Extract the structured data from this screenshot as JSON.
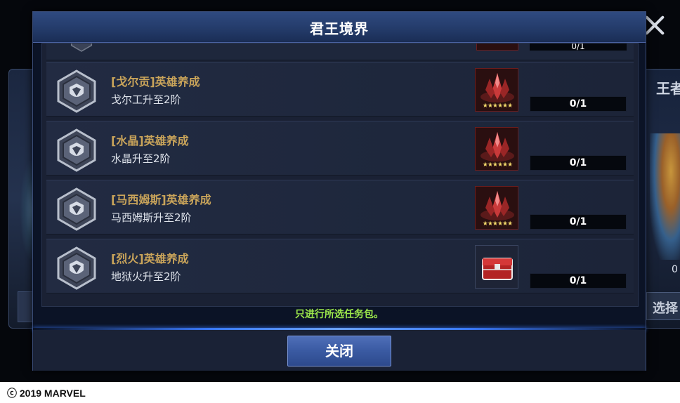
{
  "modal": {
    "title": "君王境界",
    "notice": "只进行所选任务包。",
    "close_label": "关闭"
  },
  "tasks": [
    {
      "title": "[戈尔贡]英雄养成",
      "desc": "戈尔工升至2阶",
      "reward_icon": "ruby-crystal-reward-icon",
      "reward_stars": "★★★★★★",
      "progress_text": "0/1",
      "progress_value": 0
    },
    {
      "title": "[水晶]英雄养成",
      "desc": "水晶升至2阶",
      "reward_icon": "ruby-crystal-reward-icon",
      "reward_stars": "★★★★★★",
      "progress_text": "0/1",
      "progress_value": 0
    },
    {
      "title": "[马西姆斯]英雄养成",
      "desc": "马西姆斯升至2阶",
      "reward_icon": "ruby-crystal-reward-icon",
      "reward_stars": "★★★★★★",
      "progress_text": "0/1",
      "progress_value": 0
    },
    {
      "title": "[烈火]英雄养成",
      "desc": "地狱火升至2阶",
      "reward_icon": "red-chest-reward-icon",
      "reward_stars": "",
      "progress_text": "0/1",
      "progress_value": 0
    }
  ],
  "partial_row": {
    "progress_text": "0/1"
  },
  "background": {
    "right_panel_title": "王者",
    "right_panel_count": "0",
    "right_panel_button": "选择"
  },
  "footer": {
    "copyright": "ⓒ 2019 MARVEL"
  },
  "colors": {
    "task_title": "#c9a45a",
    "notice": "#9ce84b",
    "header": "#2f4a80",
    "close_button": "#3a5aa2"
  }
}
